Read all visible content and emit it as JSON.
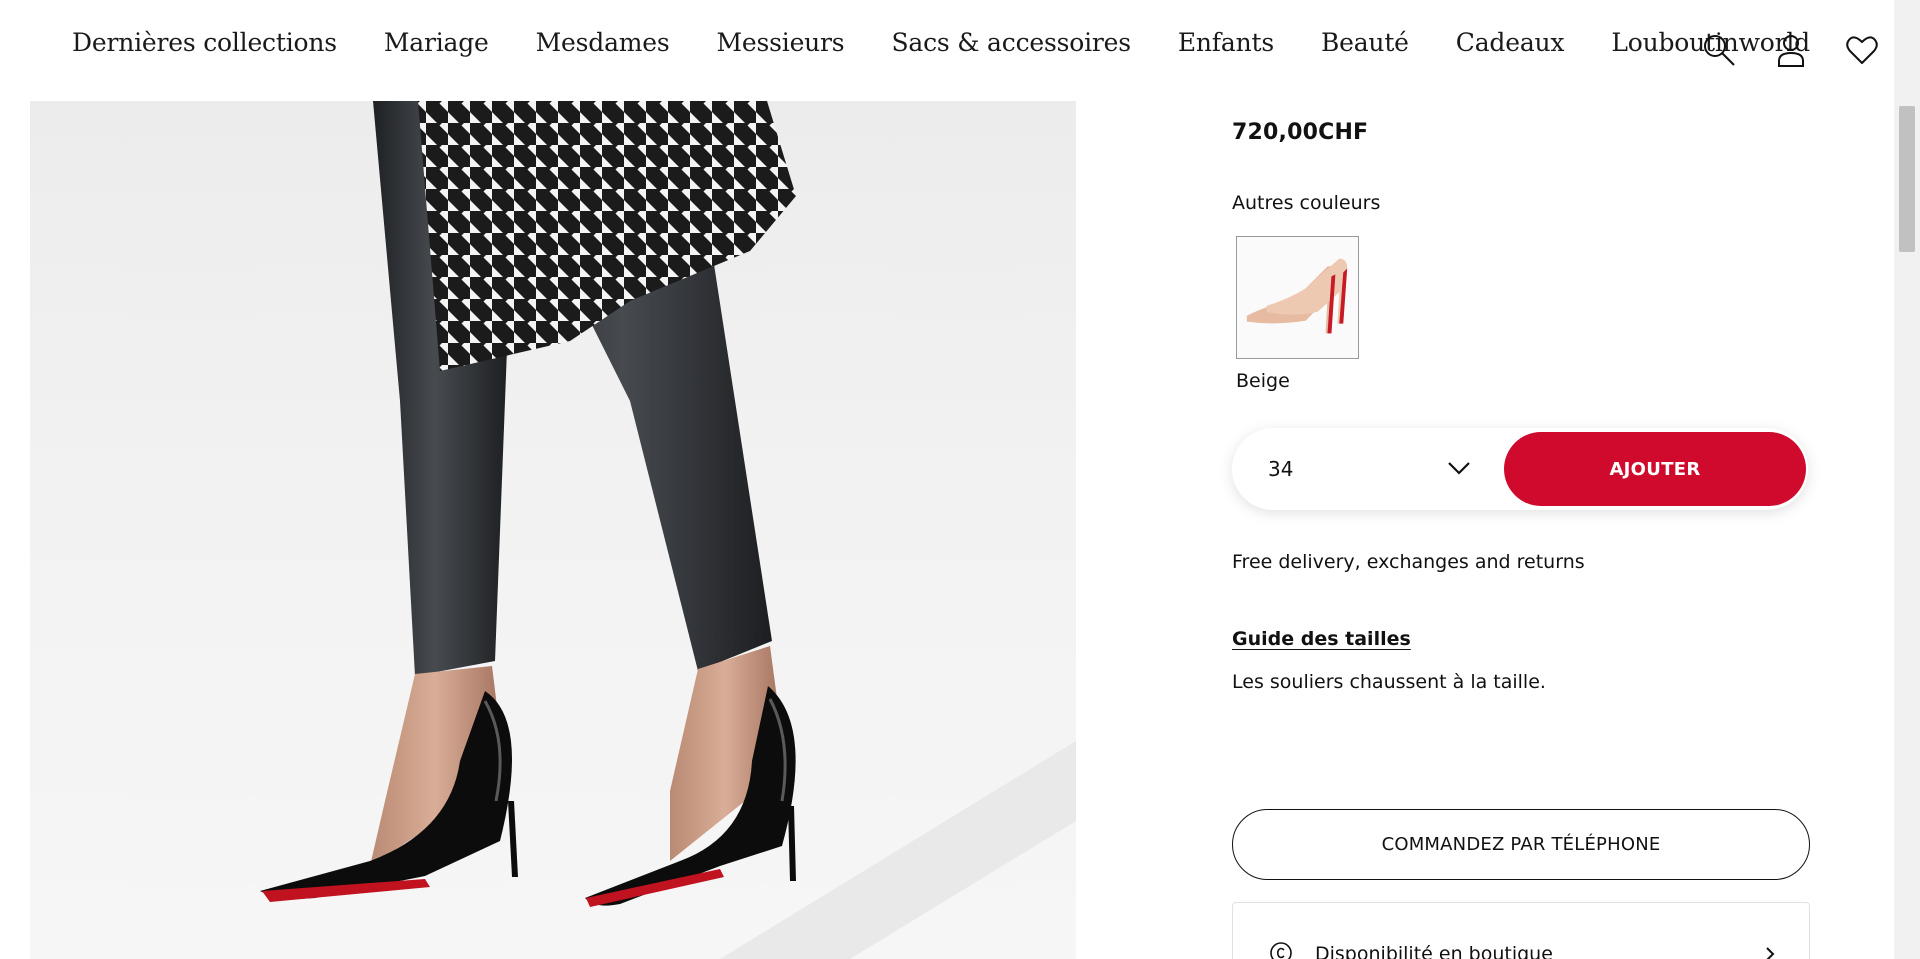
{
  "nav": {
    "items": [
      {
        "label": "Dernières collections"
      },
      {
        "label": "Mariage"
      },
      {
        "label": "Mesdames"
      },
      {
        "label": "Messieurs"
      },
      {
        "label": "Sacs & accessoires"
      },
      {
        "label": "Enfants"
      },
      {
        "label": "Beauté"
      },
      {
        "label": "Cadeaux"
      },
      {
        "label": "Louboutinworld"
      }
    ],
    "icons": [
      "search-icon",
      "account-icon",
      "wishlist-heart-icon"
    ]
  },
  "product": {
    "price": "720,00CHF",
    "other_colors_label": "Autres couleurs",
    "variants": [
      {
        "label": "Beige"
      }
    ],
    "size": {
      "selected": "34"
    },
    "add_label": "AJOUTER",
    "delivery_text": "Free delivery, exchanges and returns",
    "size_guide_label": "Guide des tailles",
    "fit_note": "Les souliers chaussent à la taille.",
    "phone_order_label": "COMMANDEZ PAR TÉLÉPHONE",
    "store_availability_label": "Disponibilité en boutique"
  },
  "colors": {
    "accent": "#cf0a2c",
    "text": "#111111",
    "background": "#ffffff"
  }
}
